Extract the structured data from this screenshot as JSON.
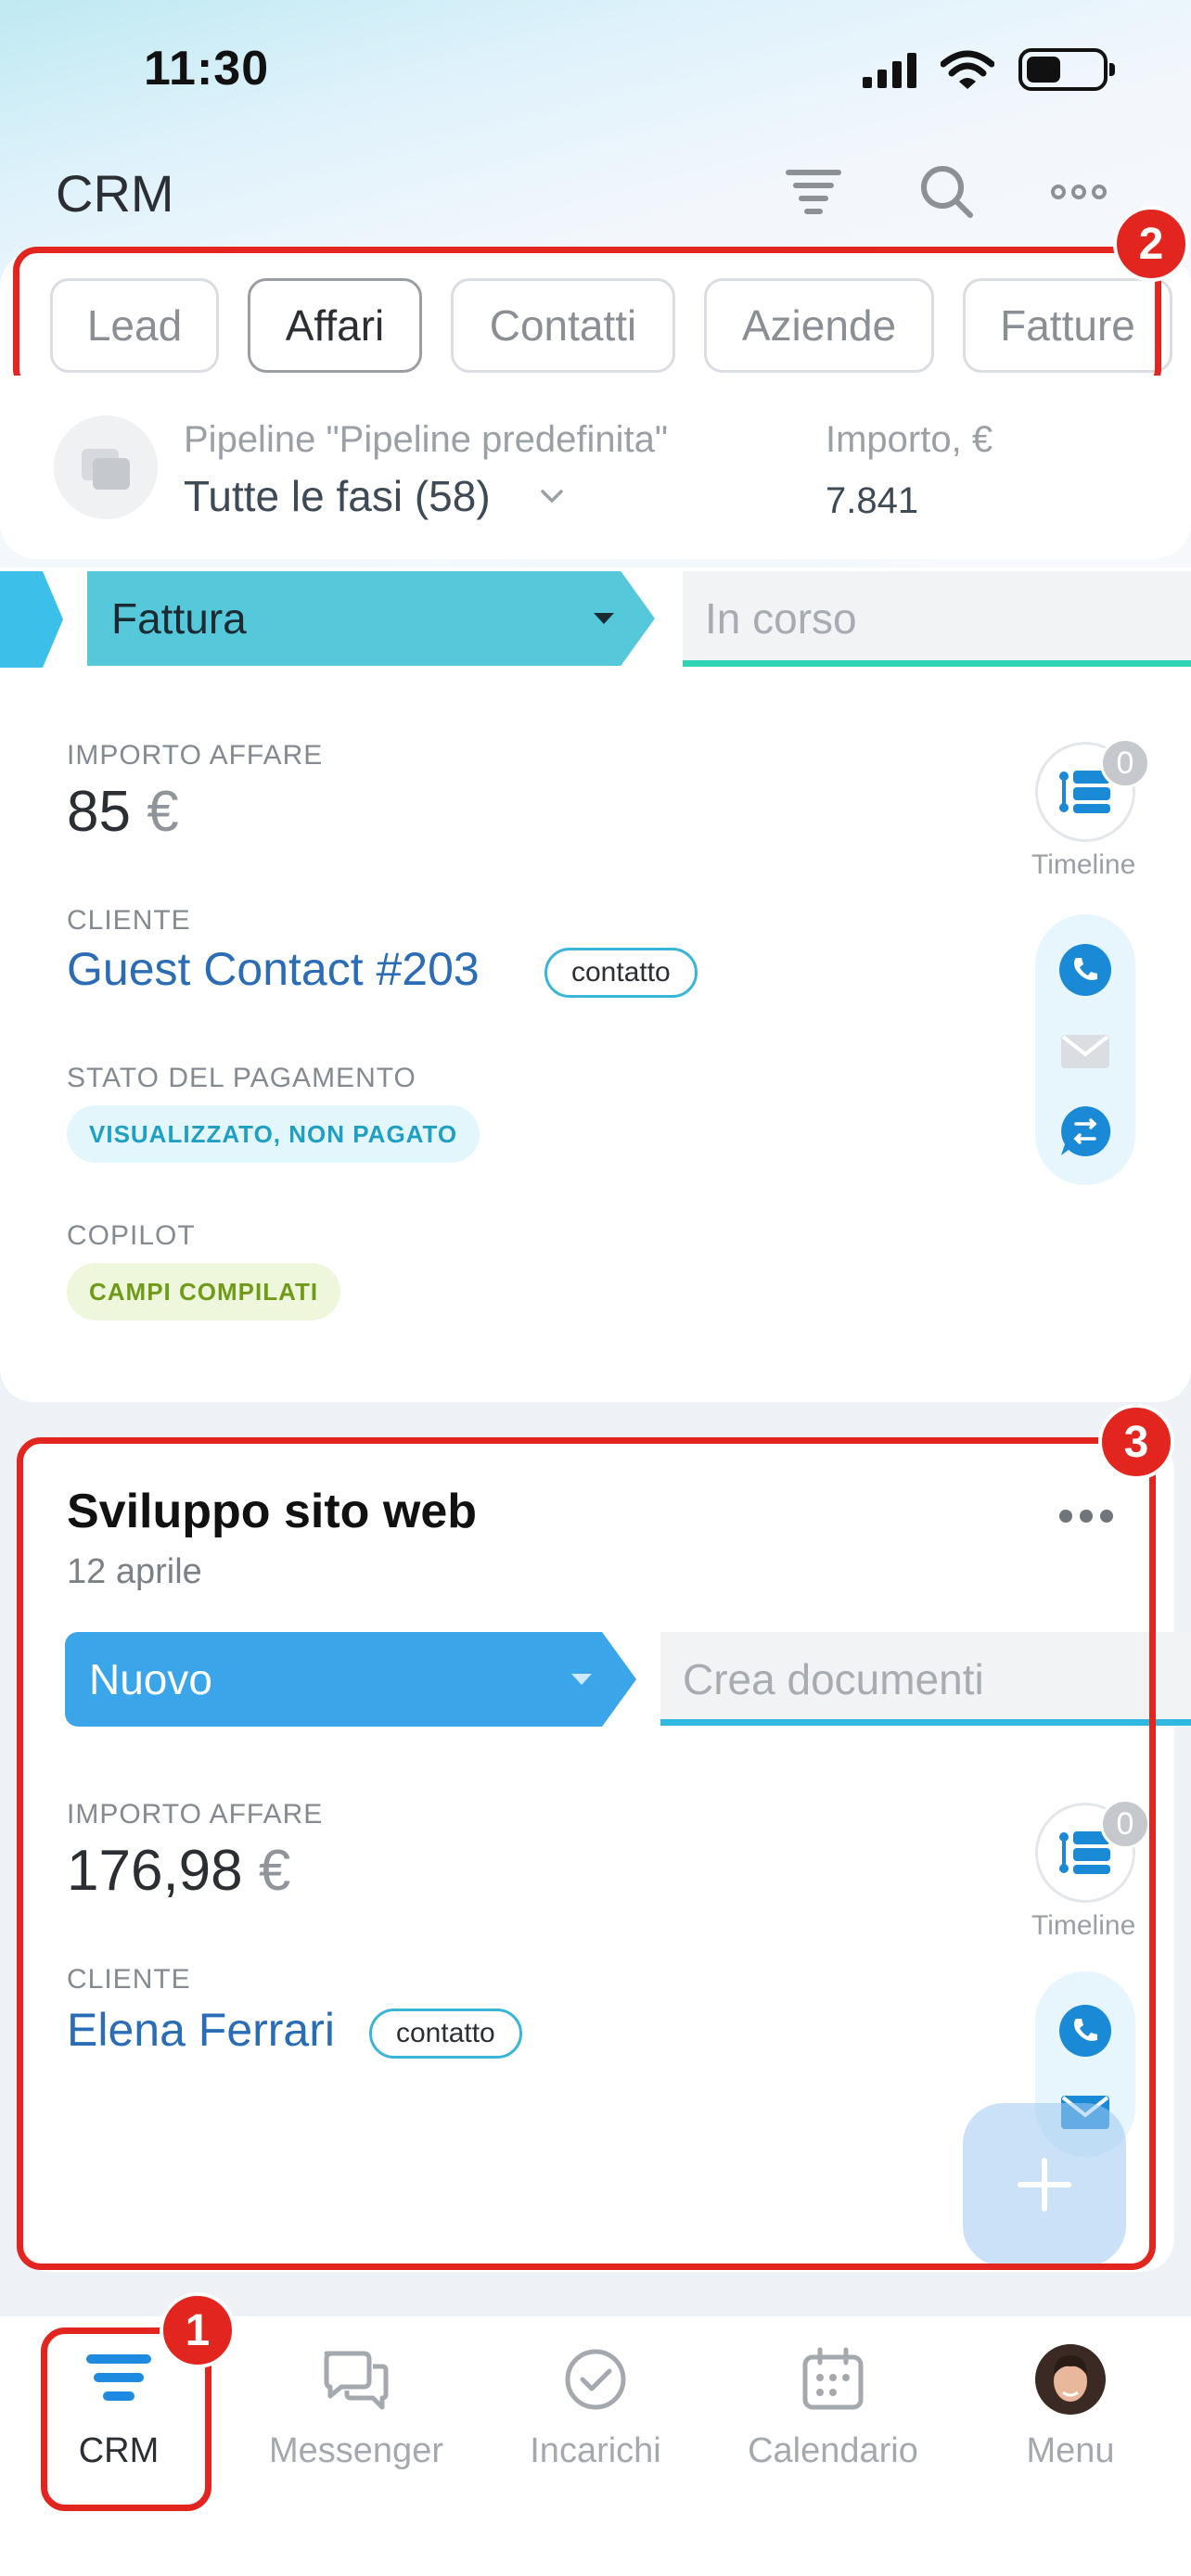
{
  "status_bar": {
    "time": "11:30"
  },
  "header": {
    "title": "CRM",
    "icons": [
      "filter-icon",
      "search-icon",
      "more-icon"
    ]
  },
  "tabs": [
    {
      "label": "Lead",
      "active": false
    },
    {
      "label": "Affari",
      "active": true
    },
    {
      "label": "Contatti",
      "active": false
    },
    {
      "label": "Aziende",
      "active": false
    },
    {
      "label": "Fatture",
      "active": false
    }
  ],
  "pipeline": {
    "label": "Pipeline \"Pipeline predefinita\"",
    "stages_label": "Tutte le fasi (58)",
    "amount_label": "Importo, €",
    "amount_value": "7.841"
  },
  "card1": {
    "stage": "Fattura",
    "stage_color": "#55c9da",
    "next_stage": "In corso",
    "next_stage_color": "#2fd3b6",
    "amount_label": "IMPORTO AFFARE",
    "amount": "85",
    "currency": "€",
    "client_label": "CLIENTE",
    "client": "Guest Contact #203",
    "client_type": "contatto",
    "payment_label": "STATO DEL PAGAMENTO",
    "payment_status": "VISUALIZZATO, NON PAGATO",
    "copilot_label": "COPILOT",
    "copilot_status": "CAMPI COMPILATI",
    "timeline_count": "0",
    "timeline_label": "Timeline"
  },
  "card2": {
    "title": "Sviluppo sito web",
    "date": "12 aprile",
    "stage": "Nuovo",
    "stage_color": "#3aa5e8",
    "next_stage": "Crea documenti",
    "next_stage_color": "#2fb9e0",
    "amount_label": "IMPORTO AFFARE",
    "amount": "176,98",
    "currency": "€",
    "client_label": "CLIENTE",
    "client": "Elena Ferrari",
    "client_type": "contatto",
    "timeline_count": "0",
    "timeline_label": "Timeline"
  },
  "annotations": [
    "1",
    "2",
    "3"
  ],
  "bottom_nav": [
    {
      "label": "CRM",
      "icon": "crm-icon",
      "active": true
    },
    {
      "label": "Messenger",
      "icon": "messenger-icon",
      "active": false
    },
    {
      "label": "Incarichi",
      "icon": "tasks-icon",
      "active": false
    },
    {
      "label": "Calendario",
      "icon": "calendar-icon",
      "active": false
    },
    {
      "label": "Menu",
      "icon": "avatar",
      "active": false
    }
  ]
}
